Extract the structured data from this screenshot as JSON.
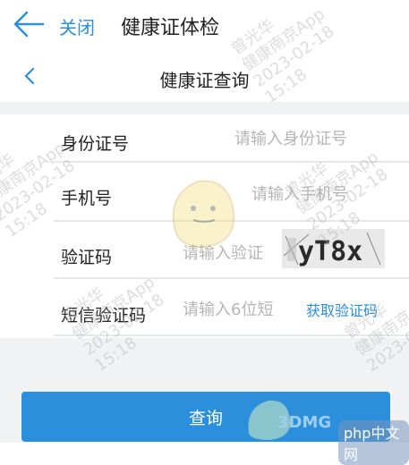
{
  "header": {
    "close_label": "关闭",
    "title": "健康证体检"
  },
  "subheader": {
    "title": "健康证查询"
  },
  "form": {
    "id_number": {
      "label": "身份证号",
      "placeholder": "请输入身份证号"
    },
    "phone": {
      "label": "手机号",
      "placeholder": "请输入手机号"
    },
    "captcha": {
      "label": "验证码",
      "placeholder": "请输入验证",
      "image_text": "yT8x"
    },
    "sms": {
      "label": "短信验证码",
      "placeholder": "请输入6位短",
      "get_code_label": "获取验证码"
    }
  },
  "submit_label": "查询",
  "watermark": {
    "name": "曾光华",
    "app": "健康南京App",
    "date": "2023-02-18",
    "time": "15:18"
  },
  "site_watermark": {
    "brand": "3DMGAME",
    "site": "php中文网"
  },
  "colors": {
    "accent": "#2b8fdc",
    "divider": "#e6e7e9",
    "background_gray": "#f1f2f4"
  }
}
